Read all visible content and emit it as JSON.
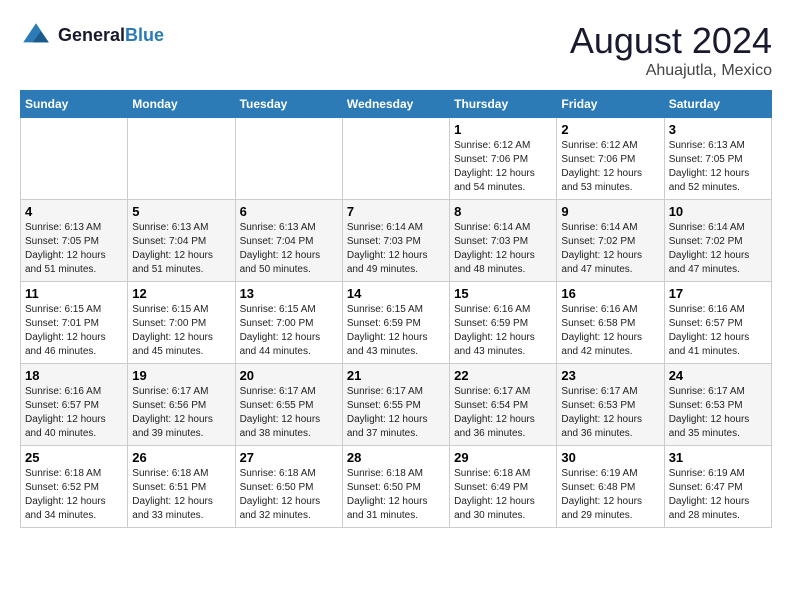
{
  "header": {
    "logo_line1": "General",
    "logo_line2": "Blue",
    "main_title": "August 2024",
    "subtitle": "Ahuajutla, Mexico"
  },
  "days_of_week": [
    "Sunday",
    "Monday",
    "Tuesday",
    "Wednesday",
    "Thursday",
    "Friday",
    "Saturday"
  ],
  "weeks": [
    [
      {
        "day": "",
        "info": ""
      },
      {
        "day": "",
        "info": ""
      },
      {
        "day": "",
        "info": ""
      },
      {
        "day": "",
        "info": ""
      },
      {
        "day": "1",
        "info": "Sunrise: 6:12 AM\nSunset: 7:06 PM\nDaylight: 12 hours\nand 54 minutes."
      },
      {
        "day": "2",
        "info": "Sunrise: 6:12 AM\nSunset: 7:06 PM\nDaylight: 12 hours\nand 53 minutes."
      },
      {
        "day": "3",
        "info": "Sunrise: 6:13 AM\nSunset: 7:05 PM\nDaylight: 12 hours\nand 52 minutes."
      }
    ],
    [
      {
        "day": "4",
        "info": "Sunrise: 6:13 AM\nSunset: 7:05 PM\nDaylight: 12 hours\nand 51 minutes."
      },
      {
        "day": "5",
        "info": "Sunrise: 6:13 AM\nSunset: 7:04 PM\nDaylight: 12 hours\nand 51 minutes."
      },
      {
        "day": "6",
        "info": "Sunrise: 6:13 AM\nSunset: 7:04 PM\nDaylight: 12 hours\nand 50 minutes."
      },
      {
        "day": "7",
        "info": "Sunrise: 6:14 AM\nSunset: 7:03 PM\nDaylight: 12 hours\nand 49 minutes."
      },
      {
        "day": "8",
        "info": "Sunrise: 6:14 AM\nSunset: 7:03 PM\nDaylight: 12 hours\nand 48 minutes."
      },
      {
        "day": "9",
        "info": "Sunrise: 6:14 AM\nSunset: 7:02 PM\nDaylight: 12 hours\nand 47 minutes."
      },
      {
        "day": "10",
        "info": "Sunrise: 6:14 AM\nSunset: 7:02 PM\nDaylight: 12 hours\nand 47 minutes."
      }
    ],
    [
      {
        "day": "11",
        "info": "Sunrise: 6:15 AM\nSunset: 7:01 PM\nDaylight: 12 hours\nand 46 minutes."
      },
      {
        "day": "12",
        "info": "Sunrise: 6:15 AM\nSunset: 7:00 PM\nDaylight: 12 hours\nand 45 minutes."
      },
      {
        "day": "13",
        "info": "Sunrise: 6:15 AM\nSunset: 7:00 PM\nDaylight: 12 hours\nand 44 minutes."
      },
      {
        "day": "14",
        "info": "Sunrise: 6:15 AM\nSunset: 6:59 PM\nDaylight: 12 hours\nand 43 minutes."
      },
      {
        "day": "15",
        "info": "Sunrise: 6:16 AM\nSunset: 6:59 PM\nDaylight: 12 hours\nand 43 minutes."
      },
      {
        "day": "16",
        "info": "Sunrise: 6:16 AM\nSunset: 6:58 PM\nDaylight: 12 hours\nand 42 minutes."
      },
      {
        "day": "17",
        "info": "Sunrise: 6:16 AM\nSunset: 6:57 PM\nDaylight: 12 hours\nand 41 minutes."
      }
    ],
    [
      {
        "day": "18",
        "info": "Sunrise: 6:16 AM\nSunset: 6:57 PM\nDaylight: 12 hours\nand 40 minutes."
      },
      {
        "day": "19",
        "info": "Sunrise: 6:17 AM\nSunset: 6:56 PM\nDaylight: 12 hours\nand 39 minutes."
      },
      {
        "day": "20",
        "info": "Sunrise: 6:17 AM\nSunset: 6:55 PM\nDaylight: 12 hours\nand 38 minutes."
      },
      {
        "day": "21",
        "info": "Sunrise: 6:17 AM\nSunset: 6:55 PM\nDaylight: 12 hours\nand 37 minutes."
      },
      {
        "day": "22",
        "info": "Sunrise: 6:17 AM\nSunset: 6:54 PM\nDaylight: 12 hours\nand 36 minutes."
      },
      {
        "day": "23",
        "info": "Sunrise: 6:17 AM\nSunset: 6:53 PM\nDaylight: 12 hours\nand 36 minutes."
      },
      {
        "day": "24",
        "info": "Sunrise: 6:17 AM\nSunset: 6:53 PM\nDaylight: 12 hours\nand 35 minutes."
      }
    ],
    [
      {
        "day": "25",
        "info": "Sunrise: 6:18 AM\nSunset: 6:52 PM\nDaylight: 12 hours\nand 34 minutes."
      },
      {
        "day": "26",
        "info": "Sunrise: 6:18 AM\nSunset: 6:51 PM\nDaylight: 12 hours\nand 33 minutes."
      },
      {
        "day": "27",
        "info": "Sunrise: 6:18 AM\nSunset: 6:50 PM\nDaylight: 12 hours\nand 32 minutes."
      },
      {
        "day": "28",
        "info": "Sunrise: 6:18 AM\nSunset: 6:50 PM\nDaylight: 12 hours\nand 31 minutes."
      },
      {
        "day": "29",
        "info": "Sunrise: 6:18 AM\nSunset: 6:49 PM\nDaylight: 12 hours\nand 30 minutes."
      },
      {
        "day": "30",
        "info": "Sunrise: 6:19 AM\nSunset: 6:48 PM\nDaylight: 12 hours\nand 29 minutes."
      },
      {
        "day": "31",
        "info": "Sunrise: 6:19 AM\nSunset: 6:47 PM\nDaylight: 12 hours\nand 28 minutes."
      }
    ]
  ]
}
